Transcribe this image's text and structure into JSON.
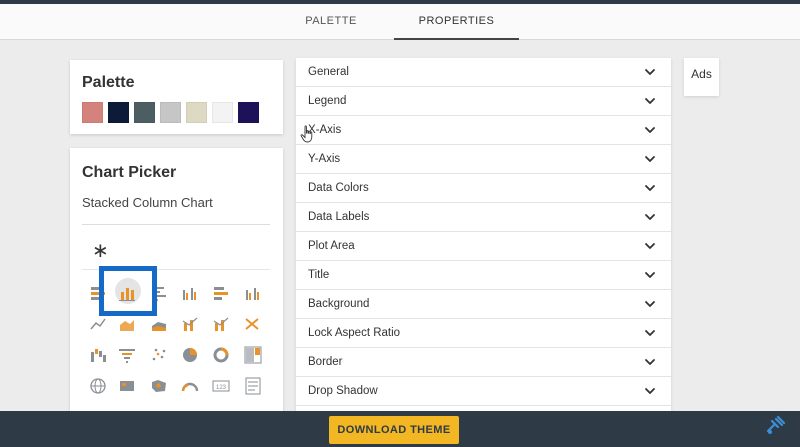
{
  "tabs": {
    "palette": "PALETTE",
    "properties": "PROPERTIES",
    "active": "PROPERTIES"
  },
  "palette_card": {
    "title": "Palette",
    "swatches": [
      "#d4837c",
      "#0d1a38",
      "#4c5e62",
      "#c6c6c6",
      "#ddd9c3",
      "#f3f3f3",
      "#1d1259"
    ]
  },
  "chart_picker": {
    "title": "Chart Picker",
    "selected_chart": "Stacked Column Chart",
    "star_symbol": "∗",
    "icons": [
      "stacked-bar-chart-icon",
      "stacked-column-chart-icon",
      "clustered-bar-chart-icon",
      "clustered-column-chart-icon",
      "100-percent-stacked-bar-chart-icon",
      "100-percent-stacked-column-chart-icon",
      "line-chart-icon",
      "area-chart-icon",
      "stacked-area-chart-icon",
      "line-and-stacked-column-chart-icon",
      "line-and-clustered-column-chart-icon",
      "ribbon-chart-icon",
      "waterfall-chart-icon",
      "funnel-chart-icon",
      "scatter-chart-icon",
      "pie-chart-icon",
      "donut-chart-icon",
      "treemap-chart-icon",
      "map-icon",
      "filled-map-icon",
      "shape-map-icon",
      "gauge-chart-icon",
      "card-visual-icon",
      "multi-row-card-icon"
    ]
  },
  "properties": {
    "sections": [
      "General",
      "Legend",
      "X-Axis",
      "Y-Axis",
      "Data Colors",
      "Data Labels",
      "Plot Area",
      "Title",
      "Background",
      "Lock Aspect Ratio",
      "Border",
      "Drop Shadow"
    ]
  },
  "ads": {
    "label": "Ads"
  },
  "footer": {
    "download_label": "DOWNLOAD THEME"
  },
  "colors": {
    "accent": "#f2b722",
    "footer_bg": "#2e3a46",
    "selection_ring": "#1569c7",
    "icon_orange": "#e8922a",
    "icon_gray": "#8a8f96"
  }
}
